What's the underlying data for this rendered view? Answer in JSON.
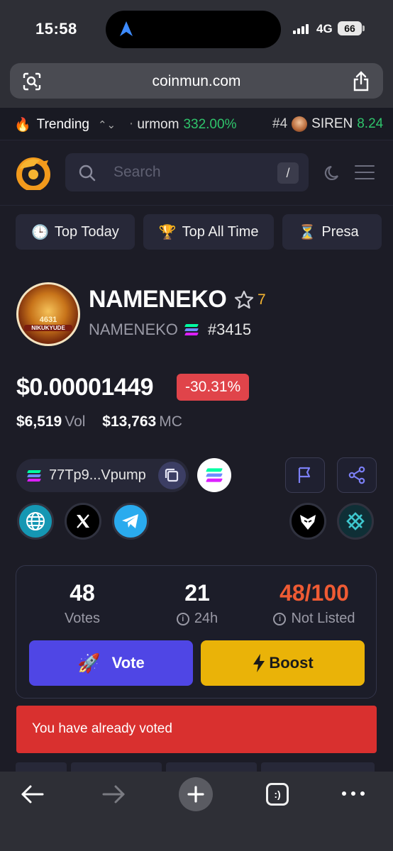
{
  "status_bar": {
    "time": "15:58",
    "network": "4G",
    "battery": "66"
  },
  "browser": {
    "url": "coinmun.com"
  },
  "trending": {
    "label": "Trending",
    "item1_name": "urmom",
    "item1_change": "332.00%",
    "item2_rank": "#4",
    "item2_name": "SIREN",
    "item2_change": "8.24"
  },
  "header": {
    "search_placeholder": "Search",
    "search_shortcut": "/"
  },
  "tabs": [
    {
      "icon": "🕒",
      "label": "Top Today"
    },
    {
      "icon": "🏆",
      "label": "Top All Time"
    },
    {
      "icon": "⏳",
      "label": "Presa"
    }
  ],
  "token": {
    "image_text": "4631",
    "image_subtext": "NIKUKYUDE",
    "name": "NAMENEKO",
    "watch_count": "7",
    "symbol": "NAMENEKO",
    "rank": "#3415",
    "price": "$0.00001449",
    "change": "-30.31%",
    "volume": "$6,519",
    "volume_label": "Vol",
    "market_cap": "$13,763",
    "market_cap_label": "MC",
    "address": "77Tp9...Vpump"
  },
  "votes_card": {
    "votes_value": "48",
    "votes_label": "Votes",
    "day_value": "21",
    "day_label": "24h",
    "listing_value": "48/100",
    "listing_label": "Not Listed",
    "vote_button": "Vote",
    "boost_button": "Boost"
  },
  "alert": {
    "message": "You have already voted"
  },
  "colors": {
    "background": "#1c1c26",
    "positive": "#2fc46b",
    "negative": "#e0444a",
    "vote": "#4f46e5",
    "boost": "#eab308",
    "listing": "#ef5b34",
    "alert": "#d9302f",
    "star_count": "#f5b431"
  }
}
